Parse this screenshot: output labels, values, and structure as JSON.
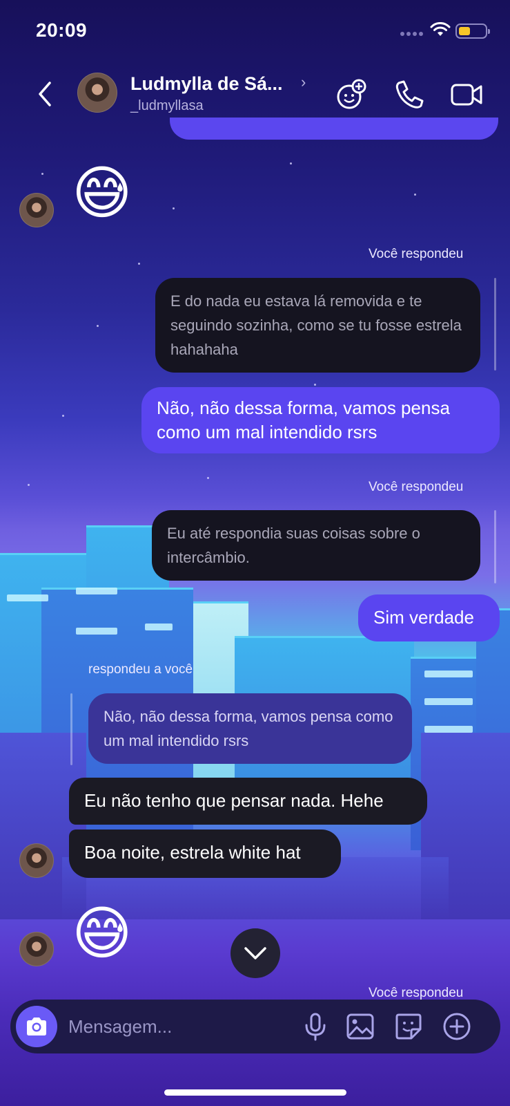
{
  "status_bar": {
    "time": "20:09"
  },
  "header": {
    "name": "Ludmylla de Sá...",
    "username": "_ludmyllasa",
    "chevron": "›",
    "icons": [
      "back-arrow-icon",
      "effects-icon",
      "phone-icon",
      "video-camera-icon"
    ]
  },
  "messages": {
    "emoji1": "😅",
    "reply_label_1": "Você respondeu",
    "quoted_1": "E do nada eu estava lá removida e te seguindo sozinha, como se tu fosse estrela hahahaha",
    "sent_1": "Não, não dessa forma, vamos pensa como um mal intendido rsrs",
    "reply_label_2": "Você respondeu",
    "quoted_2": "Eu até respondia suas coisas sobre o intercâmbio.",
    "sent_2": "Sim verdade",
    "reply_label_3": "respondeu a você",
    "quoted_3": "Não, não dessa forma, vamos pensa como um mal intendido rsrs",
    "recv_1": "Eu não tenho que pensar nada. Hehe",
    "recv_2": "Boa noite, estrela white hat",
    "emoji2": "😅",
    "reply_label_4": "Você respondeu"
  },
  "composer": {
    "placeholder": "Mensagem...",
    "icons": [
      "camera-icon",
      "microphone-icon",
      "gallery-icon",
      "sticker-icon",
      "add-icon"
    ]
  },
  "colors": {
    "sent_bubble": "#5a45f0",
    "received_bubble": "#1b1a24",
    "accent": "#6a5af6"
  }
}
